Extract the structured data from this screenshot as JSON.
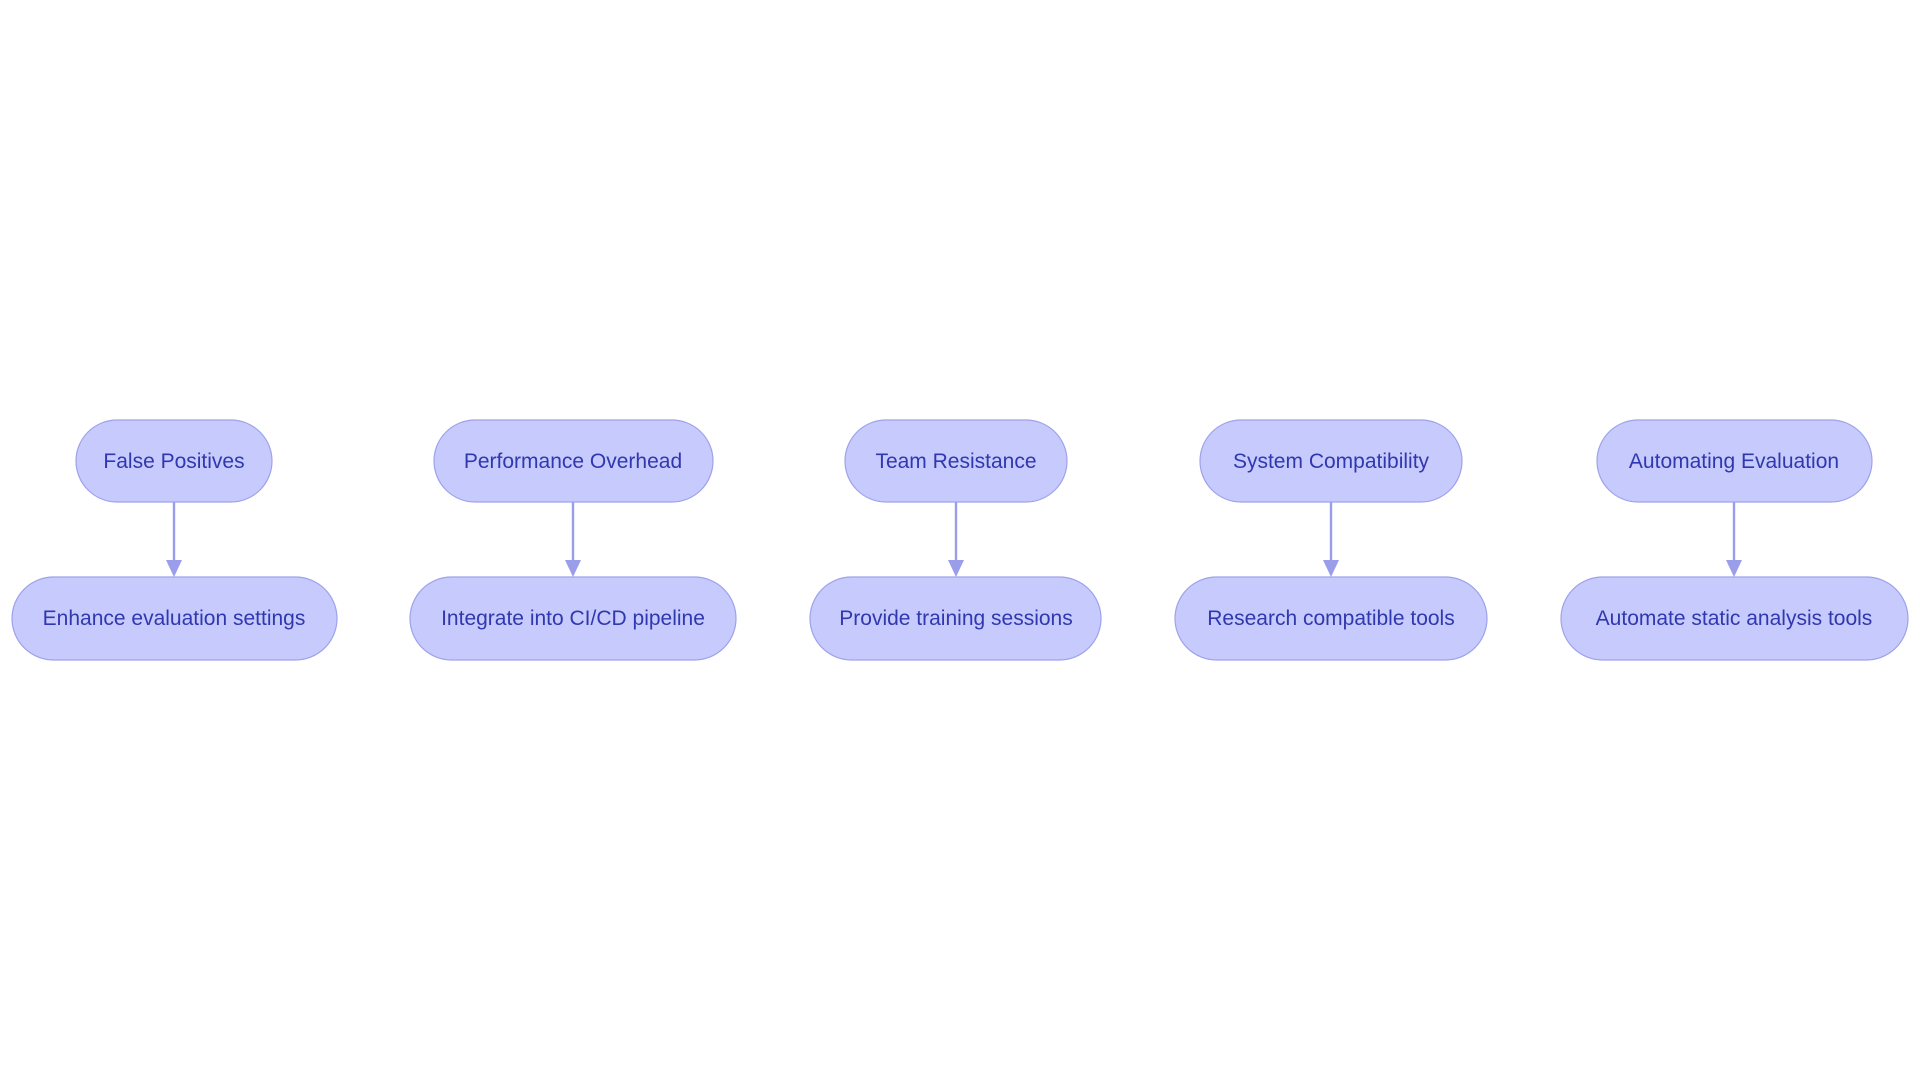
{
  "diagram": {
    "type": "flowchart",
    "direction": "top-down",
    "colors": {
      "node_fill": "#C7CAFC",
      "node_border": "#9EA2EB",
      "node_text": "#3038B0",
      "edge": "#9A9EEA",
      "background": "#FFFFFF"
    },
    "groups": [
      {
        "challenge": "False Positives",
        "solution": "Enhance evaluation settings"
      },
      {
        "challenge": "Performance Overhead",
        "solution": "Integrate into CI/CD pipeline"
      },
      {
        "challenge": "Team Resistance",
        "solution": "Provide training sessions"
      },
      {
        "challenge": "System Compatibility",
        "solution": "Research compatible tools"
      },
      {
        "challenge": "Automating Evaluation",
        "solution": "Automate static analysis tools"
      }
    ]
  }
}
